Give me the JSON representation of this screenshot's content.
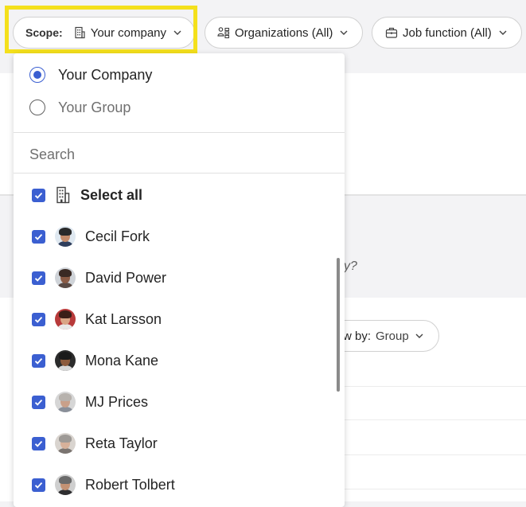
{
  "filters": {
    "scope": {
      "label": "Scope:",
      "value": "Your company",
      "icon": "building-icon"
    },
    "organizations": {
      "label": "Organizations (All)",
      "icon": "people-org-icon"
    },
    "job_function": {
      "label": "Job function (All)",
      "icon": "briefcase-icon"
    }
  },
  "background": {
    "partial_question_mark": "y?",
    "view_by": {
      "label": "w by:",
      "value": "Group"
    }
  },
  "dropdown": {
    "scope_options": [
      {
        "label": "Your Company",
        "selected": true
      },
      {
        "label": "Your Group",
        "selected": false
      }
    ],
    "search_placeholder": "Search",
    "select_all_label": "Select all",
    "people": [
      {
        "name": "Cecil Fork",
        "checked": true
      },
      {
        "name": "David Power",
        "checked": true
      },
      {
        "name": "Kat Larsson",
        "checked": true
      },
      {
        "name": "Mona Kane",
        "checked": true
      },
      {
        "name": "MJ Prices",
        "checked": true
      },
      {
        "name": "Reta Taylor",
        "checked": true
      },
      {
        "name": "Robert Tolbert",
        "checked": true
      }
    ]
  },
  "colors": {
    "accent": "#3b5fd1",
    "highlight": "#f4e01c"
  }
}
